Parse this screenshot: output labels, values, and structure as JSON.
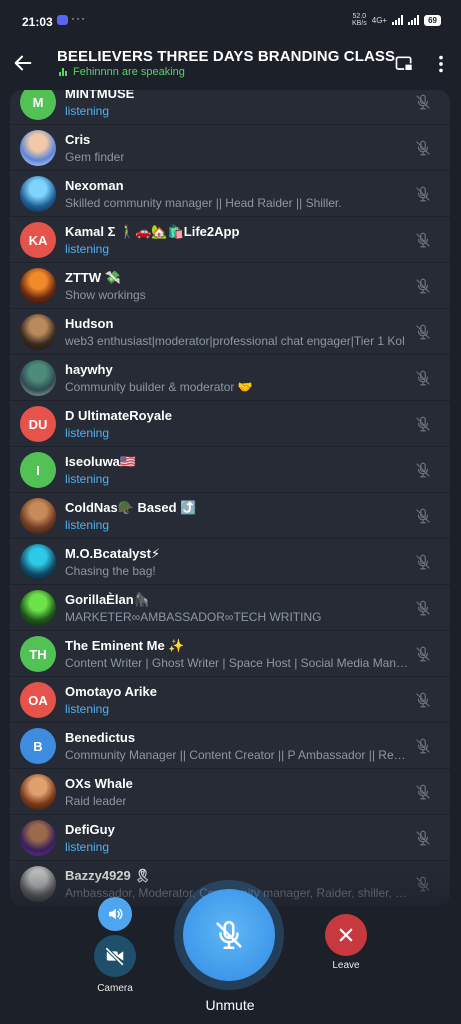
{
  "status_bar": {
    "time": "21:03",
    "dots": "···",
    "speed": "52.0",
    "speed_unit": "KB/s",
    "network": "4G+",
    "battery": "69"
  },
  "header": {
    "title": "BEELIEVERS THREE DAYS BRANDING CLASS",
    "speaking_text": "Fehinnnn are speaking"
  },
  "participants": [
    {
      "name": "MINTMUSE",
      "subtitle": "listening",
      "listening": true,
      "initials": "M",
      "color": "#52c255"
    },
    {
      "name": "Cris",
      "subtitle": "Gem finder",
      "listening": false,
      "initials": "",
      "c1": "#f2c9a8",
      "c2": "#5a86d8",
      "c3": "#e5e5f5"
    },
    {
      "name": "Nexoman",
      "subtitle": "Skilled community manager || Head Raider || Shiller.",
      "listening": false,
      "initials": "",
      "c1": "#7fd3ff",
      "c2": "#1f5f95",
      "c3": "#0b1c33"
    },
    {
      "name": "Kamal Σ 🚶‍♂️🚗🏡🛍️Life2App",
      "subtitle": "listening",
      "listening": true,
      "initials": "KA",
      "color": "#e5534b"
    },
    {
      "name": "ZTTW 💸",
      "subtitle": "Show workings",
      "listening": false,
      "initials": "",
      "c1": "#f08a2a",
      "c2": "#6b2a12",
      "c3": "#111111"
    },
    {
      "name": "Hudson",
      "subtitle": "web3 enthusiast|moderator|professional chat engager|Tier 1 Kol",
      "listening": false,
      "initials": "",
      "c1": "#b88a5e",
      "c2": "#3a2b1e",
      "c3": "#14110d"
    },
    {
      "name": "haywhy",
      "subtitle": "Community builder & moderator 🤝",
      "listening": false,
      "initials": "",
      "c1": "#4e8c7a",
      "c2": "#2e4a52",
      "c3": "#b7c6c8"
    },
    {
      "name": "D UltimateRoyale",
      "subtitle": "listening",
      "listening": true,
      "initials": "DU",
      "color": "#e5534b"
    },
    {
      "name": "Iseoluwa🇺🇸",
      "subtitle": "listening",
      "listening": true,
      "initials": "I",
      "color": "#52c255"
    },
    {
      "name": "ColdNas🪖 Based ⤴️",
      "subtitle": "listening",
      "listening": true,
      "initials": "",
      "c1": "#c98a5a",
      "c2": "#6e3b22",
      "c3": "#2a1a10"
    },
    {
      "name": "M.O.Bcatalyst⚡",
      "subtitle": "Chasing the bag!",
      "listening": false,
      "initials": "",
      "c1": "#2ec9e6",
      "c2": "#124a66",
      "c3": "#03121c"
    },
    {
      "name": "GorillaÈlan🦍",
      "subtitle": "MARKETER∞AMBASSADOR∞TECH WRITING",
      "listening": false,
      "initials": "",
      "c1": "#6de34a",
      "c2": "#1f5a1a",
      "c3": "#081808"
    },
    {
      "name": "The Eminent Me ✨",
      "subtitle": "Content Writer | Ghost Writer | Space Host | Social Media Mana...",
      "listening": false,
      "initials": "TH",
      "color": "#52c255"
    },
    {
      "name": "Omotayo Arike",
      "subtitle": "listening",
      "listening": true,
      "initials": "OA",
      "color": "#e5534b"
    },
    {
      "name": "Benedictus",
      "subtitle": "Community Manager || Content Creator || P Ambassador || Reply...",
      "listening": false,
      "initials": "B",
      "color": "#3e8ce0"
    },
    {
      "name": "OXs Whale",
      "subtitle": "Raid leader",
      "listening": false,
      "initials": "",
      "c1": "#e0a070",
      "c2": "#7a3a1a",
      "c3": "#2a120a"
    },
    {
      "name": "DefiGuy",
      "subtitle": "listening",
      "listening": true,
      "initials": "",
      "c1": "#9a6a4a",
      "c2": "#3a1f5a",
      "c3": "#6a2fb0"
    },
    {
      "name": "Bazzy4929 🎗",
      "subtitle": "Ambassador, Moderator, Community manager, Raider, shiller, B...",
      "listening": false,
      "initials": "",
      "c1": "#d8d8d8",
      "c2": "#6a6a6a",
      "c3": "#2a2a2a"
    }
  ],
  "controls": {
    "camera_label": "Camera",
    "unmute_label": "Unmute",
    "leave_label": "Leave"
  },
  "colors": {
    "background": "#1c2029",
    "row_background": "#262b36",
    "listening_blue": "#4fb1f2",
    "speaking_green": "#5ad06b",
    "unmute_blue": "#4fa6ee",
    "leave_red": "#c8393f"
  }
}
